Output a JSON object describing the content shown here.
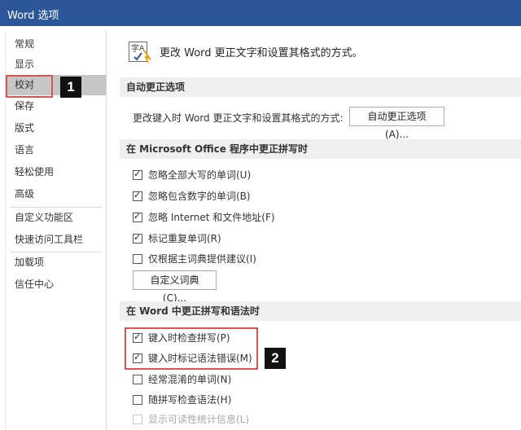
{
  "window": {
    "title": "Word 选项"
  },
  "sidebar": {
    "items": [
      {
        "label": "常规"
      },
      {
        "label": "显示"
      },
      {
        "label": "校对"
      },
      {
        "label": "保存"
      },
      {
        "label": "版式"
      },
      {
        "label": "语言"
      },
      {
        "label": "轻松使用"
      },
      {
        "label": "高级"
      },
      {
        "label": "自定义功能区"
      },
      {
        "label": "快速访问工具栏"
      },
      {
        "label": "加载项"
      },
      {
        "label": "信任中心"
      }
    ],
    "selected": "校对"
  },
  "annotations": {
    "marker1": "1",
    "marker2": "2",
    "highlight_color": "#d9534f"
  },
  "header": {
    "text": "更改 Word 更正文字和设置其格式的方式。",
    "icon": "proofing-abc-icon"
  },
  "autocorrect": {
    "section_title": "自动更正选项",
    "label": "更改键入时 Word 更正文字和设置其格式的方式:",
    "button": "自动更正选项(A)..."
  },
  "office_spelling": {
    "section_title": "在 Microsoft Office 程序中更正拼写时",
    "options": [
      {
        "label": "忽略全部大写的单词(U)",
        "checked": true
      },
      {
        "label": "忽略包含数字的单词(B)",
        "checked": true
      },
      {
        "label": "忽略 Internet 和文件地址(F)",
        "checked": true
      },
      {
        "label": "标记重复单词(R)",
        "checked": true
      },
      {
        "label": "仅根据主词典提供建议(I)",
        "checked": false
      }
    ],
    "custom_dict_button": "自定义词典(C)..."
  },
  "word_spelling": {
    "section_title": "在 Word 中更正拼写和语法时",
    "options": [
      {
        "label": "键入时检查拼写(P)",
        "checked": true
      },
      {
        "label": "键入时标记语法错误(M)",
        "checked": true
      },
      {
        "label": "经常混淆的单词(N)",
        "checked": false
      },
      {
        "label": "随拼写检查语法(H)",
        "checked": false
      },
      {
        "label": "显示可读性统计信息(L)",
        "checked": false
      }
    ]
  },
  "colors": {
    "titlebar": "#2b579a",
    "selected_nav": "#c6c6c6",
    "section_bg": "#efefef"
  }
}
